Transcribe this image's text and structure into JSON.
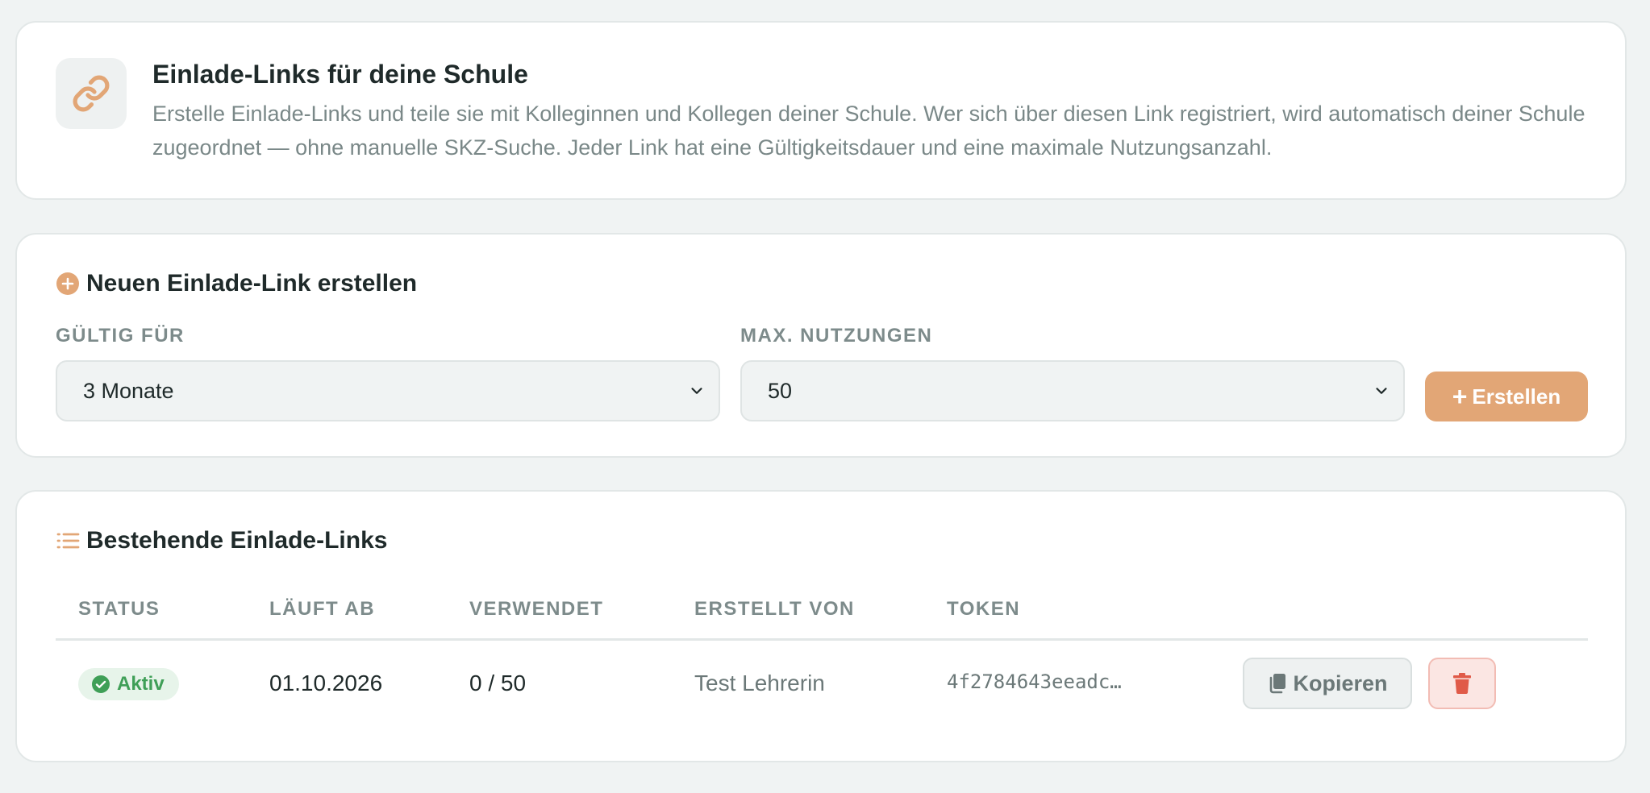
{
  "intro": {
    "icon": "link-icon",
    "title": "Einlade-Links für deine Schule",
    "description": "Erstelle Einlade-Links und teile sie mit Kolleginnen und Kollegen deiner Schule. Wer sich über diesen Link registriert, wird automatisch deiner Schule zugeordnet — ohne manuelle SKZ-Suche. Jeder Link hat eine Gültigkeitsdauer und eine maximale Nutzungsanzahl."
  },
  "create": {
    "icon": "plus-circle-icon",
    "title": "Neuen Einlade-Link erstellen",
    "validity_label": "GÜLTIG FÜR",
    "validity_value": "3 Monate",
    "max_uses_label": "MAX. NUTZUNGEN",
    "max_uses_value": "50",
    "create_button": "Erstellen"
  },
  "list": {
    "icon": "list-icon",
    "title": "Bestehende Einlade-Links",
    "columns": [
      "STATUS",
      "LÄUFT AB",
      "VERWENDET",
      "ERSTELLT VON",
      "TOKEN"
    ],
    "rows": [
      {
        "status": "Aktiv",
        "expires": "01.10.2026",
        "used": "0 / 50",
        "created_by": "Test Lehrerin",
        "token": "4f2784643eeadc…",
        "copy_label": "Kopieren"
      }
    ]
  },
  "colors": {
    "accent": "#e2a676",
    "success": "#3f9f57",
    "danger": "#e05a48",
    "background": "#f0f3f3"
  }
}
